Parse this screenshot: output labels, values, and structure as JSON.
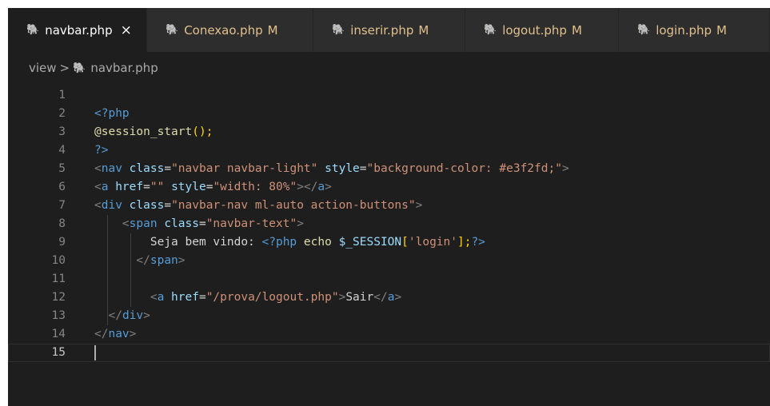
{
  "tabs": [
    {
      "label": "navbar.php",
      "modified": "",
      "close": "×",
      "active": true
    },
    {
      "label": "Conexao.php",
      "modified": "M",
      "close": "",
      "active": false
    },
    {
      "label": "inserir.php",
      "modified": "M",
      "close": "",
      "active": false
    },
    {
      "label": "logout.php",
      "modified": "M",
      "close": "",
      "active": false
    },
    {
      "label": "login.php",
      "modified": "M",
      "close": "",
      "active": false
    }
  ],
  "breadcrumb": {
    "folder": "view",
    "separator": ">",
    "file": "navbar.php"
  },
  "editor": {
    "line_numbers": [
      "1",
      "2",
      "3",
      "4",
      "5",
      "6",
      "7",
      "8",
      "9",
      "10",
      "11",
      "12",
      "13",
      "14",
      "15"
    ],
    "current_line": 15,
    "lines": [
      [],
      [
        {
          "t": "<?php",
          "c": "tag"
        }
      ],
      [
        {
          "t": "@session_start",
          "c": "fn"
        },
        {
          "t": "();",
          "c": "yl"
        }
      ],
      [
        {
          "t": "?>",
          "c": "tag"
        }
      ],
      [
        {
          "t": "<",
          "c": "br"
        },
        {
          "t": "nav",
          "c": "tag"
        },
        {
          "t": " ",
          "c": ""
        },
        {
          "t": "class",
          "c": "attr"
        },
        {
          "t": "=",
          "c": ""
        },
        {
          "t": "\"navbar navbar-light\"",
          "c": "str"
        },
        {
          "t": " ",
          "c": ""
        },
        {
          "t": "style",
          "c": "attr"
        },
        {
          "t": "=",
          "c": ""
        },
        {
          "t": "\"background-color: #e3f2fd;\"",
          "c": "str"
        },
        {
          "t": ">",
          "c": "br"
        }
      ],
      [
        {
          "t": "<",
          "c": "br"
        },
        {
          "t": "a",
          "c": "tag"
        },
        {
          "t": " ",
          "c": ""
        },
        {
          "t": "href",
          "c": "attr"
        },
        {
          "t": "=",
          "c": ""
        },
        {
          "t": "\"\"",
          "c": "str"
        },
        {
          "t": " ",
          "c": ""
        },
        {
          "t": "style",
          "c": "attr"
        },
        {
          "t": "=",
          "c": ""
        },
        {
          "t": "\"width: 80%\"",
          "c": "str"
        },
        {
          "t": "></",
          "c": "br"
        },
        {
          "t": "a",
          "c": "tag"
        },
        {
          "t": ">",
          "c": "br"
        }
      ],
      [
        {
          "t": "<",
          "c": "br"
        },
        {
          "t": "div",
          "c": "tag"
        },
        {
          "t": " ",
          "c": ""
        },
        {
          "t": "class",
          "c": "attr"
        },
        {
          "t": "=",
          "c": ""
        },
        {
          "t": "\"navbar-nav ml-auto action-buttons\"",
          "c": "str"
        },
        {
          "t": ">",
          "c": "br"
        }
      ],
      [
        {
          "t": "    ",
          "c": ""
        },
        {
          "t": "<",
          "c": "br"
        },
        {
          "t": "span",
          "c": "tag"
        },
        {
          "t": " ",
          "c": ""
        },
        {
          "t": "class",
          "c": "attr"
        },
        {
          "t": "=",
          "c": ""
        },
        {
          "t": "\"navbar-text\"",
          "c": "str"
        },
        {
          "t": ">",
          "c": "br"
        }
      ],
      [
        {
          "t": "        Seja bem vindo: ",
          "c": ""
        },
        {
          "t": "<?php",
          "c": "tag"
        },
        {
          "t": " ",
          "c": ""
        },
        {
          "t": "echo",
          "c": "fn"
        },
        {
          "t": " ",
          "c": ""
        },
        {
          "t": "$_SESSION",
          "c": "var"
        },
        {
          "t": "[",
          "c": "yl"
        },
        {
          "t": "'login'",
          "c": "str"
        },
        {
          "t": "];",
          "c": "yl"
        },
        {
          "t": "?>",
          "c": "tag"
        }
      ],
      [
        {
          "t": "      ",
          "c": ""
        },
        {
          "t": "</",
          "c": "br"
        },
        {
          "t": "span",
          "c": "tag"
        },
        {
          "t": ">",
          "c": "br"
        }
      ],
      [],
      [
        {
          "t": "        ",
          "c": ""
        },
        {
          "t": "<",
          "c": "br"
        },
        {
          "t": "a",
          "c": "tag"
        },
        {
          "t": " ",
          "c": ""
        },
        {
          "t": "href",
          "c": "attr"
        },
        {
          "t": "=",
          "c": ""
        },
        {
          "t": "\"/prova/logout.php\"",
          "c": "str"
        },
        {
          "t": ">",
          "c": "br"
        },
        {
          "t": "Sair",
          "c": ""
        },
        {
          "t": "</",
          "c": "br"
        },
        {
          "t": "a",
          "c": "tag"
        },
        {
          "t": ">",
          "c": "br"
        }
      ],
      [
        {
          "t": "  ",
          "c": ""
        },
        {
          "t": "</",
          "c": "br"
        },
        {
          "t": "div",
          "c": "tag"
        },
        {
          "t": ">",
          "c": "br"
        }
      ],
      [
        {
          "t": "</",
          "c": "br"
        },
        {
          "t": "nav",
          "c": "tag"
        },
        {
          "t": ">",
          "c": "br"
        }
      ],
      []
    ]
  }
}
